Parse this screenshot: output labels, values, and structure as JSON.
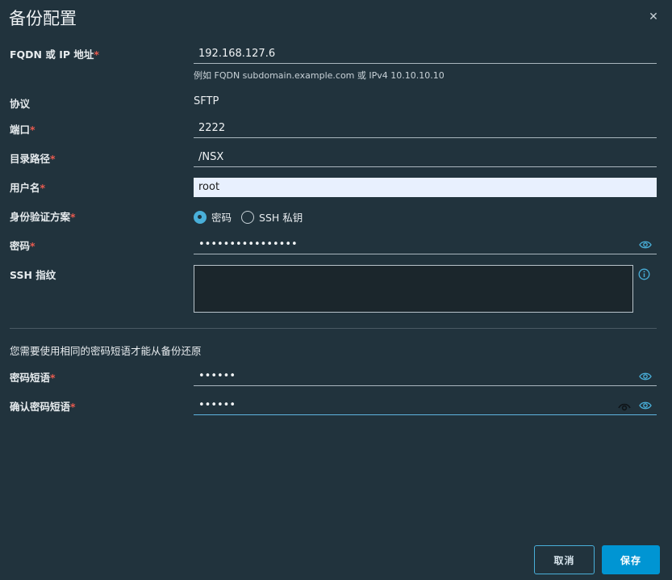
{
  "dialog": {
    "title": "备份配置",
    "close_icon": "close-icon"
  },
  "form": {
    "fqdn": {
      "label": "FQDN 或 IP 地址",
      "required_mark": "*",
      "value": "192.168.127.6",
      "helper": "例如 FQDN subdomain.example.com 或 IPv4 10.10.10.10"
    },
    "protocol": {
      "label": "协议",
      "value": "SFTP"
    },
    "port": {
      "label": "端口",
      "required_mark": "*",
      "value": "2222"
    },
    "directory": {
      "label": "目录路径",
      "required_mark": "*",
      "value": "/NSX"
    },
    "username": {
      "label": "用户名",
      "required_mark": "*",
      "value": "root"
    },
    "auth_method": {
      "label": "身份验证方案",
      "required_mark": "*",
      "options": [
        "密码",
        "SSH 私钥"
      ],
      "selected": "密码"
    },
    "password": {
      "label": "密码",
      "required_mark": "*",
      "value": "••••••••••••••••",
      "eye_icon": "eye-icon"
    },
    "ssh_fingerprint": {
      "label": "SSH 指纹",
      "value": "",
      "info_icon": "info-icon"
    },
    "passphrase_note": "您需要使用相同的密码短语才能从备份还原",
    "passphrase": {
      "label": "密码短语",
      "required_mark": "*",
      "value": "••••••",
      "eye_icon": "eye-icon"
    },
    "confirm_passphrase": {
      "label": "确认密码短语",
      "required_mark": "*",
      "value": "••••••",
      "reveal_icon": "eye-reveal-icon",
      "eye_icon": "eye-icon"
    }
  },
  "footer": {
    "cancel_label": "取消",
    "save_label": "保存"
  },
  "colors": {
    "background": "#21333d",
    "accent": "#0095d3",
    "required": "#e85a4f",
    "link_blue": "#49afd9"
  }
}
